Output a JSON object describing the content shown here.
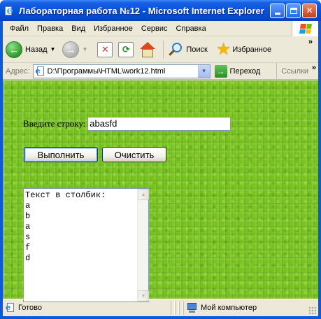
{
  "window": {
    "title": "Лабораторная работа №12 - Microsoft Internet Explorer"
  },
  "menu": {
    "items": [
      "Файл",
      "Правка",
      "Вид",
      "Избранное",
      "Сервис",
      "Справка"
    ]
  },
  "toolbar": {
    "back_label": "Назад",
    "search_label": "Поиск",
    "favorites_label": "Избранное"
  },
  "address": {
    "label": "Адрес:",
    "url": "D:\\Программы\\HTML\\work12.html",
    "go_label": "Переход",
    "links_label": "Ссылки"
  },
  "form": {
    "prompt_label": "Введите строку:",
    "input_value": "abasfd",
    "execute_label": "Выполнить",
    "clear_label": "Очистить",
    "output_text": "Текст в столбик:\na\nb\na\ns\nf\nd"
  },
  "status": {
    "text": "Готово",
    "zone": "Мой компьютер"
  },
  "colors": {
    "titlebar": "#0552db",
    "content_bg": "#79c321",
    "chrome": "#ece9d8"
  }
}
